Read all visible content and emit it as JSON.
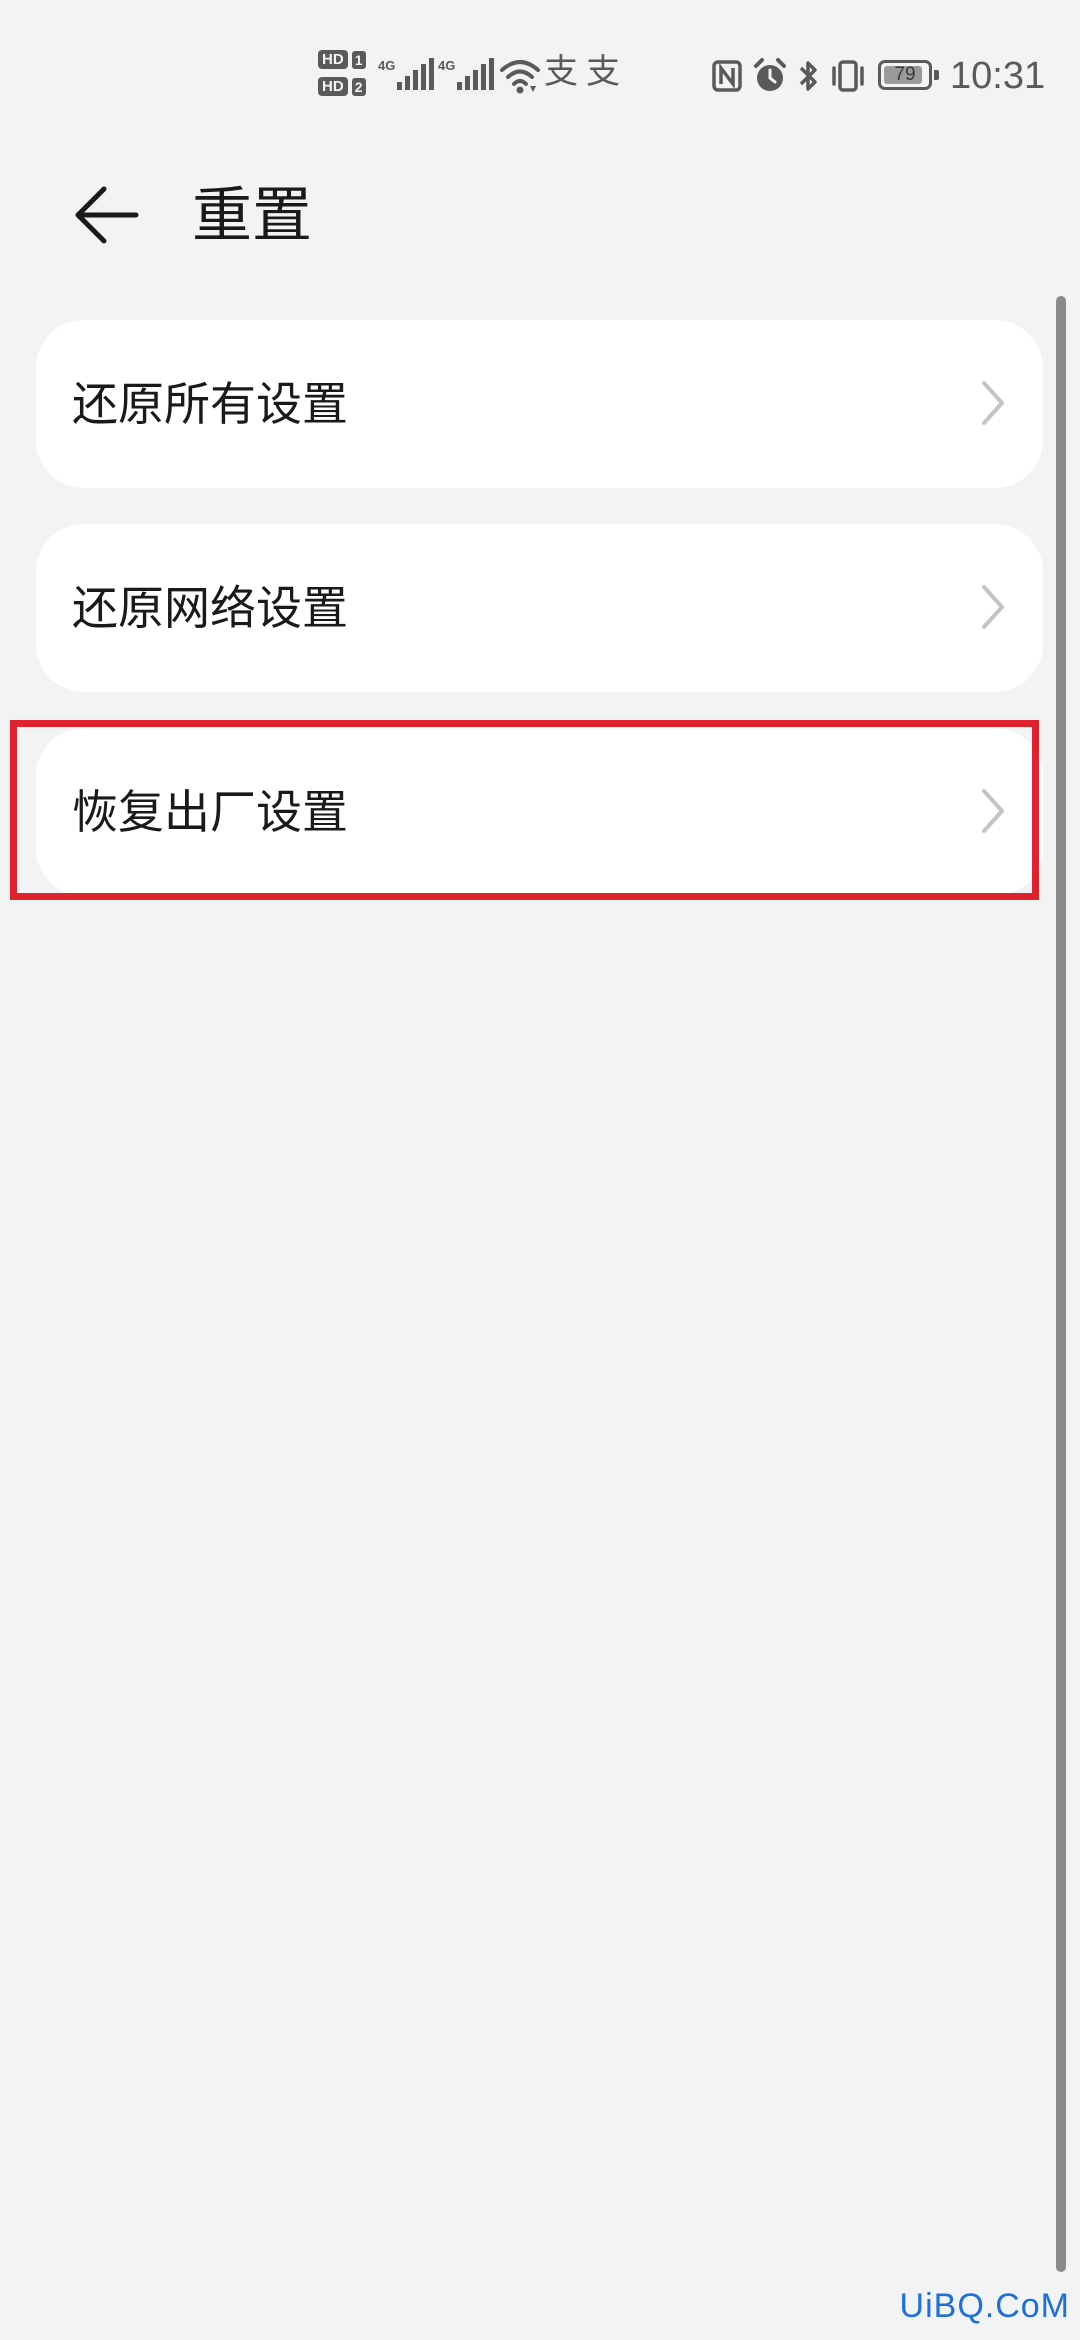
{
  "status_bar": {
    "sim_badge": "HD",
    "sim1": "1",
    "sim2": "2",
    "network1": "4G",
    "network2": "4G",
    "battery_level": "79",
    "time": "10:31",
    "icons": [
      "hd-badge-icon",
      "signal-icon",
      "wifi-icon",
      "alipay-icon",
      "nfc-icon",
      "alarm-icon",
      "bluetooth-icon",
      "vibrate-icon",
      "battery-icon"
    ]
  },
  "header": {
    "back_icon": "arrow-left-icon",
    "title": "重置"
  },
  "list": {
    "items": [
      {
        "label": "还原所有设置",
        "chevron": "chevron-right-icon"
      },
      {
        "label": "还原网络设置",
        "chevron": "chevron-right-icon"
      },
      {
        "label": "恢复出厂设置",
        "chevron": "chevron-right-icon",
        "highlighted": true
      }
    ]
  },
  "annotation": {
    "highlight_color": "#e0222e"
  },
  "watermark": "UiBQ.CoM"
}
